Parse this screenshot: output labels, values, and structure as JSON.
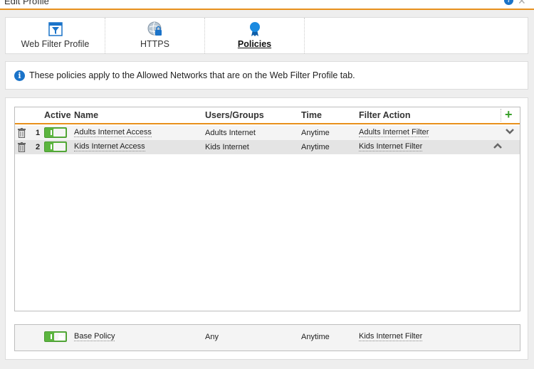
{
  "window": {
    "title": "Edit Profile",
    "help_icon": "help-icon",
    "close_icon": "close-icon"
  },
  "tabs": [
    {
      "label": "Web Filter Profile",
      "icon": "funnel-icon",
      "active": false
    },
    {
      "label": "HTTPS",
      "icon": "globe-lock-icon",
      "active": false
    },
    {
      "label": "Policies",
      "icon": "ribbon-icon",
      "active": true
    }
  ],
  "info": {
    "text": "These policies apply to the Allowed Networks that are on the Web Filter Profile tab."
  },
  "table": {
    "headers": {
      "active": "Active",
      "name": "Name",
      "users": "Users/Groups",
      "time": "Time",
      "filter": "Filter Action",
      "add": "+"
    },
    "rows": [
      {
        "num": "1",
        "active": true,
        "name": "Adults Internet Access",
        "users": "Adults Internet",
        "time": "Anytime",
        "filter": "Adults Internet Filter"
      },
      {
        "num": "2",
        "active": true,
        "name": "Kids Internet Access",
        "users": "Kids Internet",
        "time": "Anytime",
        "filter": "Kids Internet Filter"
      }
    ]
  },
  "base_policy": {
    "active": true,
    "locked": true,
    "name": "Base Policy",
    "users": "Any",
    "time": "Anytime",
    "filter": "Kids Internet Filter"
  },
  "colors": {
    "accent": "#e8901c",
    "toggle_on": "#5cb53f",
    "info_blue": "#1a73c9",
    "add_green": "#3aa02c"
  }
}
